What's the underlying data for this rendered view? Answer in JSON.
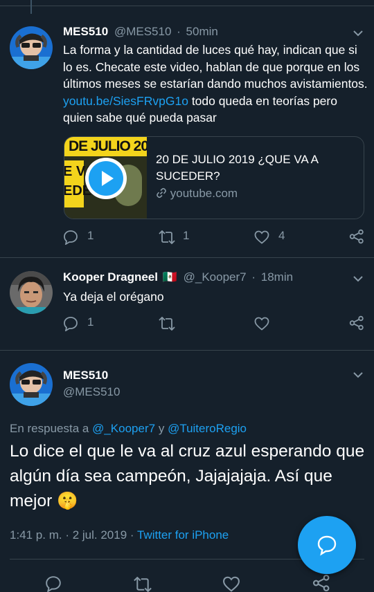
{
  "tweet1": {
    "name": "MES510",
    "handle": "@MES510",
    "dot": "·",
    "time": "50min",
    "text_part1": "La forma y la cantidad de luces qué hay, indican que si lo es. Checate este video, hablan de que porque en los últimos meses se estarían dando muchos avistamientos.",
    "text_link": "youtu.be/SiesFRvpG1o",
    "text_part2": "todo queda en teorías pero quien sabe qué pueda pasar",
    "card": {
      "thumb_text_top": "DE JULIO 20",
      "thumb_text_left": "E VA\nEDER!",
      "title": "20 DE JULIO 2019 ¿QUE VA A SUCEDER?",
      "domain": "youtube.com"
    },
    "replies": "1",
    "retweets": "1",
    "likes": "4"
  },
  "tweet2": {
    "name": "Kooper Dragneel",
    "flag": "🇲🇽",
    "handle": "@_Kooper7",
    "dot": "·",
    "time": "18min",
    "text": "Ya deja el orégano",
    "replies": "1"
  },
  "tweet3": {
    "name": "MES510",
    "handle": "@MES510",
    "reply_prefix": "En respuesta a",
    "reply_user1": "@_Kooper7",
    "reply_and": "y",
    "reply_user2": "@TuiteroRegio",
    "text": "Lo dice el que le va al cruz azul esperando que algún día sea campeón, Jajajajaja. Así que mejor 🤫",
    "timestamp": "1:41 p. m. · 2 jul. 2019 ·",
    "source": "Twitter for iPhone"
  },
  "colors": {
    "background": "#15202b",
    "accent": "#1da1f2",
    "muted": "#8899a6",
    "divider": "#38444d"
  },
  "icons": [
    "chevron-down-icon",
    "reply-icon",
    "retweet-icon",
    "like-icon",
    "share-icon",
    "link-icon",
    "play-icon",
    "compose-icon"
  ]
}
